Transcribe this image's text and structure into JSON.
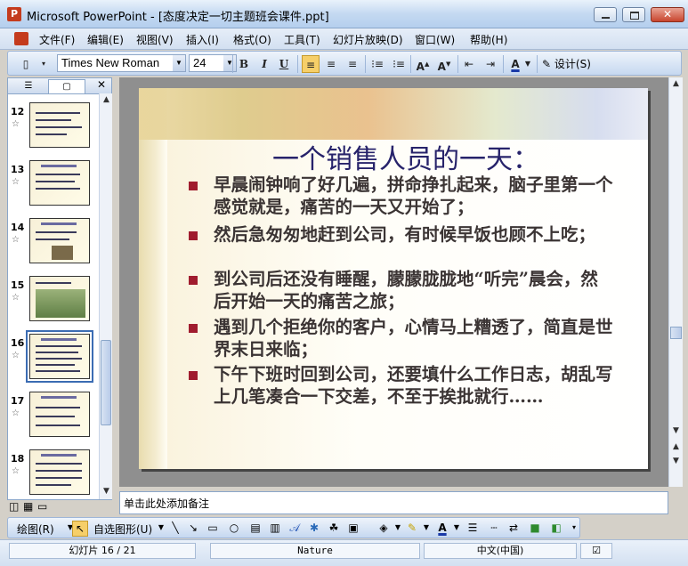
{
  "window": {
    "title": "Microsoft PowerPoint - [态度决定一切主题班会课件.ppt]"
  },
  "menu": {
    "items": [
      "文件(F)",
      "编辑(E)",
      "视图(V)",
      "插入(I)",
      "格式(O)",
      "工具(T)",
      "幻灯片放映(D)",
      "窗口(W)",
      "帮助(H)"
    ]
  },
  "toolbar": {
    "font_name": "Times New Roman",
    "font_size": "24",
    "bold": "B",
    "italic": "I",
    "underline": "U",
    "design_label": "设计(S)"
  },
  "thumbnails": [
    {
      "num": "12"
    },
    {
      "num": "13"
    },
    {
      "num": "14"
    },
    {
      "num": "15"
    },
    {
      "num": "16"
    },
    {
      "num": "17"
    },
    {
      "num": "18"
    }
  ],
  "slide": {
    "title": "一个销售人员的一天：",
    "bullets": [
      "早晨闹钟响了好几遍，拼命挣扎起来，脑子里第一个感觉就是，痛苦的一天又开始了；",
      "然后急匆匆地赶到公司，有时候早饭也顾不上吃；",
      "到公司后还没有睡醒，朦朦胧胧地“听完”晨会，然后开始一天的痛苦之旅；",
      "遇到几个拒绝你的客户，心情马上糟透了，简直是世界末日来临；",
      "下午下班时回到公司，还要填什么工作日志，胡乱写上几笔凑合一下交差，不至于挨批就行……"
    ]
  },
  "notes": {
    "placeholder": "单击此处添加备注"
  },
  "drawing_toolbar": {
    "draw_label": "绘图(R)",
    "autoshapes_label": "自选图形(U)"
  },
  "status": {
    "slide_position": "幻灯片 16 / 21",
    "design_name": "Nature",
    "language": "中文(中国)"
  },
  "colors": {
    "title_color": "#27236b",
    "bullet_color": "#a01c2e",
    "selection_border": "#3b6cb3"
  }
}
